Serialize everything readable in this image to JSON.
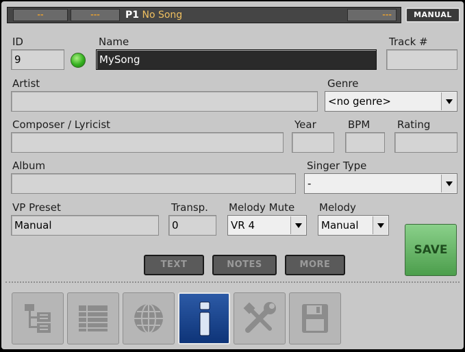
{
  "topbar": {
    "seg1": "--",
    "seg2": "---",
    "program": "P1",
    "song_name": "No Song",
    "seg_right": "---",
    "mode_badge": "MANUAL"
  },
  "form": {
    "id_label": "ID",
    "id_value": "9",
    "name_label": "Name",
    "name_value": "MySong",
    "track_label": "Track #",
    "track_value": "",
    "artist_label": "Artist",
    "artist_value": "",
    "genre_label": "Genre",
    "genre_value": "<no genre>",
    "composer_label": "Composer / Lyricist",
    "composer_value": "",
    "year_label": "Year",
    "year_value": "",
    "bpm_label": "BPM",
    "bpm_value": "",
    "rating_label": "Rating",
    "rating_value": "",
    "album_label": "Album",
    "album_value": "",
    "singer_type_label": "Singer Type",
    "singer_type_value": "-",
    "vp_preset_label": "VP Preset",
    "vp_preset_value": "Manual",
    "transp_label": "Transp.",
    "transp_value": "0",
    "melody_mute_label": "Melody Mute",
    "melody_mute_value": "VR 4",
    "melody_label": "Melody",
    "melody_value": "Manual"
  },
  "buttons": {
    "text": "TEXT",
    "notes": "NOTES",
    "more": "MORE",
    "save": "SAVE"
  },
  "tabs": [
    {
      "icon": "tree-icon",
      "active": false
    },
    {
      "icon": "list-icon",
      "active": false
    },
    {
      "icon": "globe-icon",
      "active": false
    },
    {
      "icon": "info-icon",
      "active": true
    },
    {
      "icon": "tools-icon",
      "active": false
    },
    {
      "icon": "floppy-disk-icon",
      "active": false
    }
  ],
  "colors": {
    "accent_orange": "#f0c060",
    "save_green": "#6ab86a",
    "active_tab_blue": "#1e4a92",
    "status_led_green": "#34b020"
  }
}
